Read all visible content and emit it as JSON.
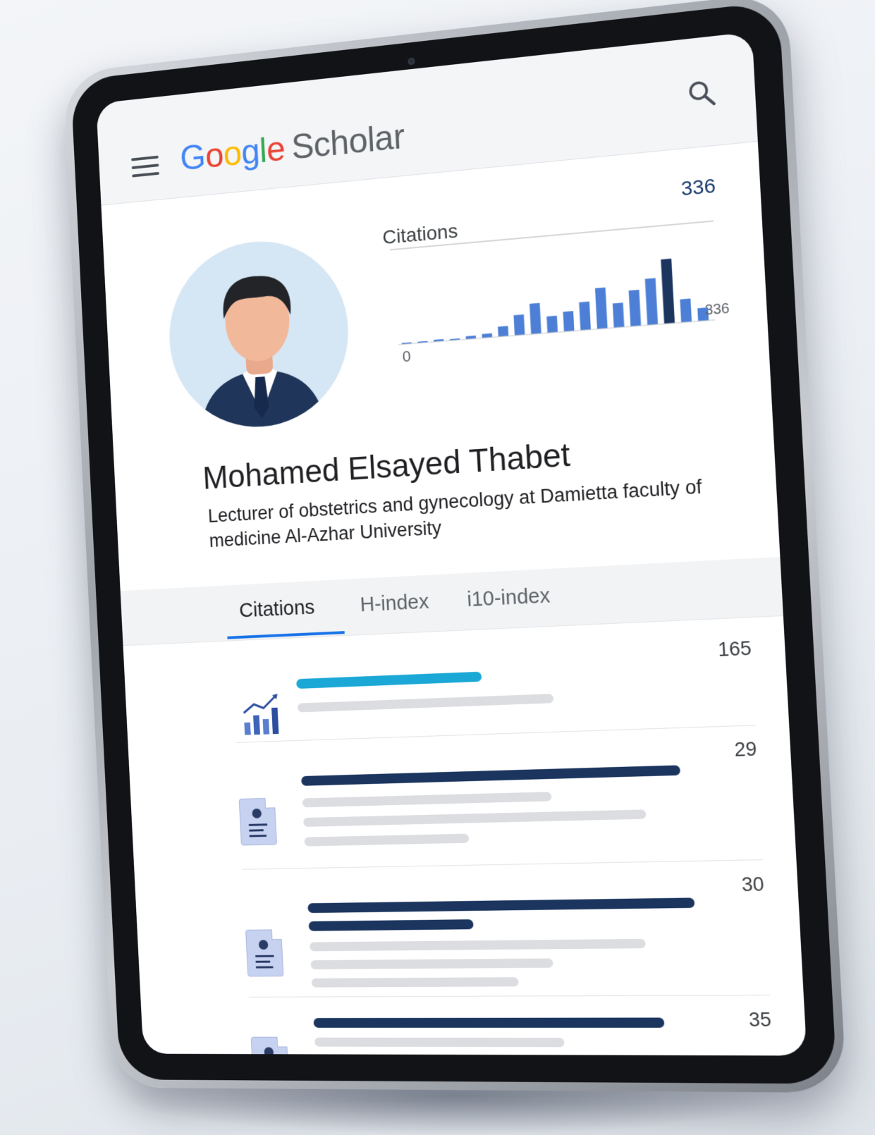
{
  "header": {
    "menu_icon": "hamburger-menu-icon",
    "logo": {
      "google": [
        "G",
        "o",
        "o",
        "g",
        "l",
        "e"
      ],
      "scholar": "Scholar"
    },
    "search_icon": "search-icon"
  },
  "profile": {
    "avatar_icon": "person-avatar",
    "name": "Mohamed Elsayed Thabet",
    "affiliation": "Lecturer of obstetrics and gynecology at Damietta faculty of medicine Al-Azhar University"
  },
  "chart_data": {
    "type": "bar",
    "title": "Citations",
    "top_value_label": "336",
    "axis_min_label": "0",
    "axis_max_label": "336",
    "ylim": [
      0,
      336
    ],
    "values": [
      3,
      5,
      8,
      6,
      12,
      16,
      40,
      80,
      120,
      65,
      78,
      110,
      160,
      95,
      140,
      180,
      250,
      90,
      50
    ],
    "colors": {
      "bar": "#4d7fd6",
      "bar_dark": "#1b355f"
    }
  },
  "tabs": [
    {
      "label": "Citations",
      "active": true
    },
    {
      "label": "H-index",
      "active": false
    },
    {
      "label": "i10-index",
      "active": false
    }
  ],
  "list": [
    {
      "icon": "bar-chart-trend-icon",
      "count": "165",
      "accent": "#1ba8d6"
    },
    {
      "icon": "document-icon",
      "count": "29"
    },
    {
      "icon": "document-icon",
      "count": "30"
    },
    {
      "icon": "document-icon",
      "count": "35"
    }
  ]
}
